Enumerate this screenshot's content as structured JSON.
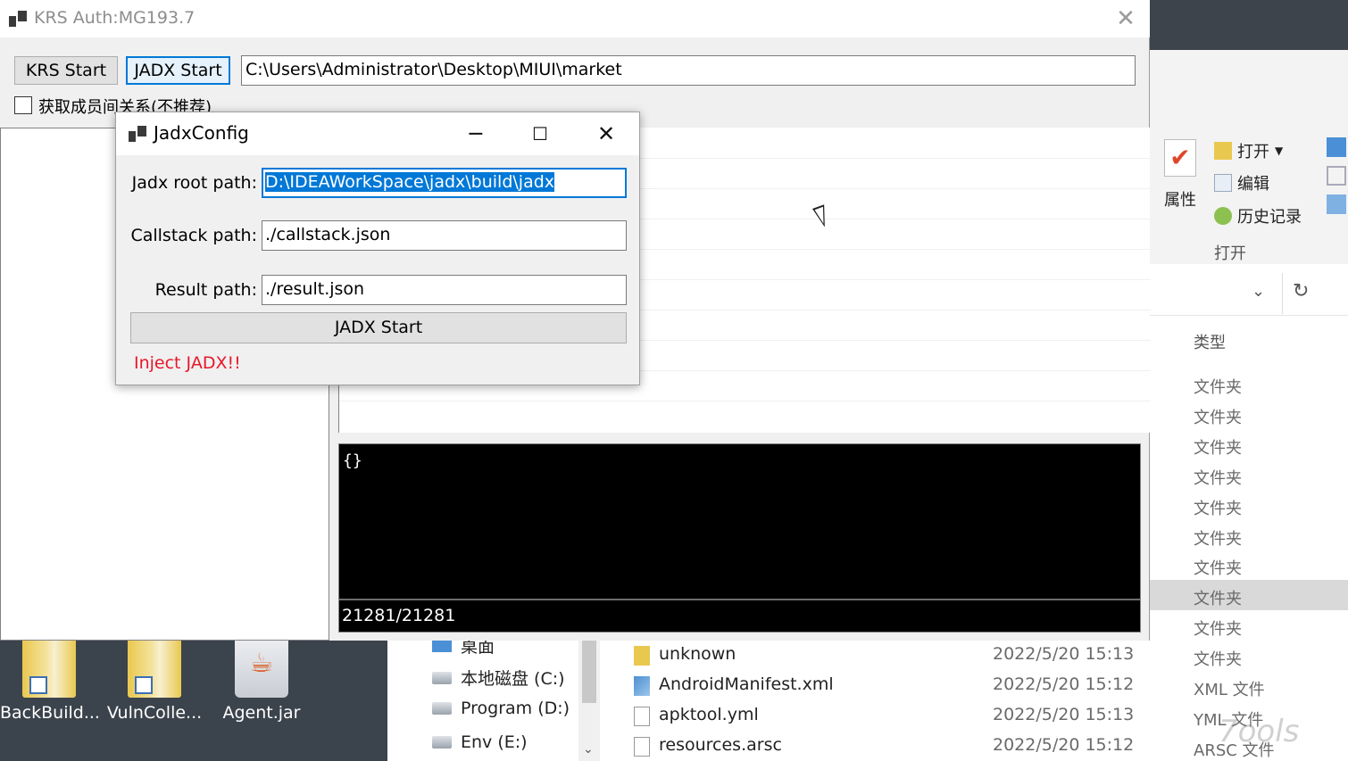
{
  "desktop": {
    "icons": [
      {
        "label": "BackBuild..."
      },
      {
        "label": "VulnColle..."
      },
      {
        "label": "Agent.jar"
      }
    ]
  },
  "main_window": {
    "title": "KRS Auth:MG193.7",
    "krs_start_label": "KRS Start",
    "jadx_start_label": "JADX Start",
    "path_value": "C:\\Users\\Administrator\\Desktop\\MIUI\\market",
    "checkbox_label": "获取成员间关系(不推荐)",
    "console_text": "{}",
    "status_text": "21281/21281"
  },
  "jadx_dialog": {
    "title": "JadxConfig",
    "root_label": "Jadx root path:",
    "root_value": "D:\\IDEAWorkSpace\\jadx\\build\\jadx",
    "callstack_label": "Callstack path:",
    "callstack_value": "./callstack.json",
    "result_label": "Result path:",
    "result_value": "./result.json",
    "start_label": "JADX Start",
    "warn_text": "Inject JADX!!",
    "warn_color": "#e8172a"
  },
  "explorer": {
    "ribbon": {
      "properties": "属性",
      "open": "打开",
      "edit": "编辑",
      "history": "历史记录",
      "group_open": "打开"
    },
    "type_header": "类型",
    "type_values": [
      "文件夹",
      "文件夹",
      "文件夹",
      "文件夹",
      "文件夹",
      "文件夹",
      "文件夹",
      "文件夹",
      "文件夹",
      "文件夹",
      "XML 文件",
      "YML 文件",
      "ARSC 文件"
    ],
    "nav_items": [
      {
        "label": "桌面"
      },
      {
        "label": "本地磁盘 (C:)"
      },
      {
        "label": "Program (D:)"
      },
      {
        "label": "Env (E:)"
      }
    ],
    "files": [
      {
        "name": "unknown",
        "date": "2022/5/20 15:13"
      },
      {
        "name": "AndroidManifest.xml",
        "date": "2022/5/20 15:12"
      },
      {
        "name": "apktool.yml",
        "date": "2022/5/20 15:13"
      },
      {
        "name": "resources.arsc",
        "date": "2022/5/20 15:12"
      }
    ]
  },
  "watermark": "7ools",
  "colors": {
    "accent": "#0078d7"
  }
}
